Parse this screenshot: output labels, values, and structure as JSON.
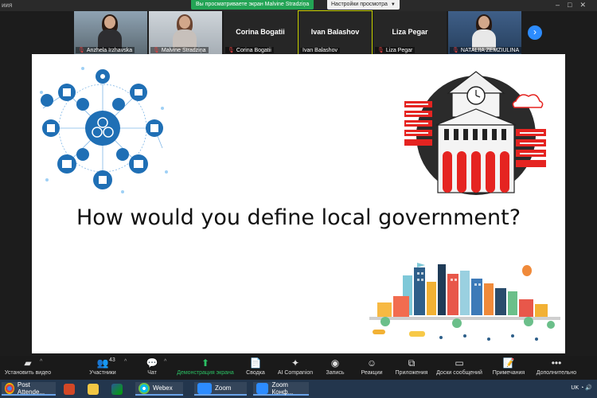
{
  "window": {
    "title": "иия"
  },
  "share": {
    "banner": "Вы просматриваете экран Malvine Stradziņa",
    "view_options": "Настройки просмотра"
  },
  "participants": [
    {
      "name": "Anzhela Irzhavska",
      "muted": true,
      "video": true
    },
    {
      "name": "Malvine Stradziņa",
      "muted": true,
      "video": true
    },
    {
      "name": "Corina Bogatii",
      "muted": true,
      "video": false,
      "center": "Corina Bogatii"
    },
    {
      "name": "Ivan Balashov",
      "muted": false,
      "video": false,
      "center": "Ivan Balashov",
      "active": true
    },
    {
      "name": "Liza Pegar",
      "muted": true,
      "video": false,
      "center": "Liza Pegar"
    },
    {
      "name": "NATALIIA ZEMZIULINA",
      "muted": true,
      "video": true
    }
  ],
  "slide": {
    "question": "How would you define local government?"
  },
  "toolbar": {
    "video": "Установить видео",
    "participants": "Участники",
    "participants_count": "43",
    "chat": "Чат",
    "share": "Демонстрация экрана",
    "summary": "Сводка",
    "ai": "AI Companion",
    "record": "Запись",
    "reactions": "Реакции",
    "apps": "Приложения",
    "whiteboards": "Доски сообщений",
    "notes": "Примечания",
    "more": "Дополнительно"
  },
  "taskbar": {
    "chrome_task": "Post Attende...",
    "webex": "Webex",
    "zoom1": "Zoom",
    "zoom2": "Zoom Конф...",
    "locale": "UK"
  },
  "colors": {
    "share_green": "#23a455",
    "zoom_blue": "#2d8cff",
    "slide_accent": "#e52421",
    "network_blue": "#1f6fb5"
  }
}
